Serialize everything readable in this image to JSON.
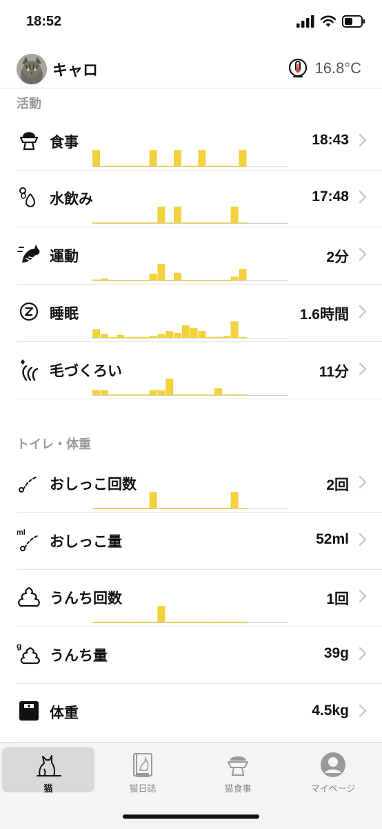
{
  "status": {
    "time": "18:52"
  },
  "header": {
    "cat_name": "キャロ",
    "temperature": "16.8°C"
  },
  "sections": {
    "activity": "活動",
    "toilet": "トイレ・体重"
  },
  "rows": [
    {
      "key": "meal",
      "label": "食事",
      "value": "18:43",
      "icon": "food-bowl-icon",
      "bars": [
        0.85,
        0,
        0,
        0,
        0,
        0,
        0,
        0.85,
        0,
        0,
        0.85,
        0,
        0,
        0.85,
        0,
        0,
        0,
        0,
        0.85
      ]
    },
    {
      "key": "water",
      "label": "水飲み",
      "value": "17:48",
      "icon": "water-drop-icon",
      "bars": [
        0,
        0,
        0,
        0,
        0,
        0,
        0,
        0,
        0.85,
        0,
        0.85,
        0,
        0,
        0,
        0,
        0,
        0,
        0.85,
        0
      ]
    },
    {
      "key": "exercise",
      "label": "運動",
      "value": "2分",
      "icon": "running-cat-icon",
      "bars": [
        0.05,
        0.1,
        0,
        0,
        0,
        0,
        0,
        0.35,
        0.85,
        0,
        0.4,
        0,
        0,
        0,
        0,
        0,
        0,
        0.2,
        0.6
      ]
    },
    {
      "key": "sleep",
      "label": "睡眠",
      "value": "1.6時間",
      "icon": "sleep-icon",
      "bars": [
        0.45,
        0.2,
        0,
        0.15,
        0,
        0,
        0,
        0.1,
        0.2,
        0.35,
        0.25,
        0.65,
        0.5,
        0.35,
        0,
        0.05,
        0.1,
        0.85,
        0
      ]
    },
    {
      "key": "grooming",
      "label": "毛づくろい",
      "value": "11分",
      "icon": "grooming-icon",
      "bars": [
        0.25,
        0.25,
        0,
        0,
        0,
        0,
        0,
        0.25,
        0.25,
        0.85,
        0,
        0,
        0,
        0,
        0,
        0.35,
        0,
        0.05,
        0
      ]
    },
    {
      "key": "pee-count",
      "label": "おしっこ回数",
      "value": "2回",
      "icon": "pee-count-icon",
      "bars": [
        0,
        0,
        0,
        0,
        0,
        0,
        0,
        0.85,
        0,
        0,
        0,
        0,
        0,
        0,
        0,
        0,
        0,
        0.85,
        0
      ]
    },
    {
      "key": "pee-amount",
      "label": "おしっこ量",
      "value": "52ml",
      "icon": "pee-amount-icon",
      "bars": []
    },
    {
      "key": "poop-count",
      "label": "うんち回数",
      "value": "1回",
      "icon": "poop-count-icon",
      "bars": [
        0,
        0,
        0,
        0,
        0,
        0,
        0,
        0,
        0.85,
        0,
        0,
        0,
        0,
        0,
        0,
        0,
        0,
        0,
        0
      ]
    },
    {
      "key": "poop-amount",
      "label": "うんち量",
      "value": "39g",
      "icon": "poop-amount-icon",
      "bars": []
    },
    {
      "key": "weight",
      "label": "体重",
      "value": "4.5kg",
      "icon": "scale-icon",
      "bars": []
    }
  ],
  "tabs": [
    {
      "label": "猫",
      "icon": "cat-icon",
      "active": true
    },
    {
      "label": "猫日誌",
      "icon": "diary-icon",
      "active": false
    },
    {
      "label": "猫食事",
      "icon": "food-bowl-icon",
      "active": false
    },
    {
      "label": "マイページ",
      "icon": "profile-icon",
      "active": false
    }
  ],
  "colors": {
    "bar": "#f2d13c",
    "baseline": "#cfcfcf",
    "chevron": "#c7c7cc",
    "tab_inactive": "#999999"
  }
}
